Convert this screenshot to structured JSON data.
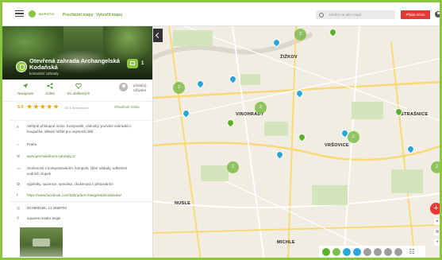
{
  "header": {
    "brand": "MAPOTIC",
    "nav_browse": "Procházet mapy",
    "nav_create": "Vytvořit mapu",
    "search_placeholder": "Hledat na této mapě",
    "add_place": "Přidat místo"
  },
  "place": {
    "title_line1": "Otevřená zahrada Archangelská",
    "title_line2": "Kodaňská",
    "subtitle": "komunitní zahrady",
    "photo_count": "1",
    "actions": {
      "navigate": "Navigovat",
      "share": "Sdílet",
      "favorite": "Do oblíbených"
    },
    "uploader_line1": "přidal(a)",
    "uploader_line2": "Uživatel",
    "rating_value": "5.0",
    "stars": "★★★★★",
    "rating_count": "Od 1 hodnotících",
    "rate_link": "Ohodnotit místo",
    "description": [
      "Veřejně přístupné místo. Kompostér, záhonky, pozvání zahradníci,",
      "houpačka, dětské hřiště pro nejmenší děti."
    ],
    "city": "Praha",
    "website": "www.permakulturni-zahrady.cz",
    "experience": [
      "zkušenosti s kompostováním, kompost, čtění nádady, odhezení",
      "vodních zlupek"
    ],
    "program": "výpěstky, sazenice, semínka, zkušenosti s pěstováním",
    "facebook": "https://www.facebook.com/ZahradaArchangelskaKodanska/",
    "gps": "50.0690196, 14.4659794",
    "address": "squares reader angle"
  },
  "map": {
    "labels": [
      "ŽIŽKOV",
      "VINOHRADY",
      "VRŠOVICE",
      "STRAŠNICE",
      "NUSLE",
      "MICHLE"
    ],
    "clusters": [
      "2",
      "2",
      "2",
      "2",
      "2",
      "2"
    ]
  },
  "colors": {
    "accent": "#8cc63f",
    "primary_button": "#e53935",
    "marker_blue": "#29a7d8"
  }
}
